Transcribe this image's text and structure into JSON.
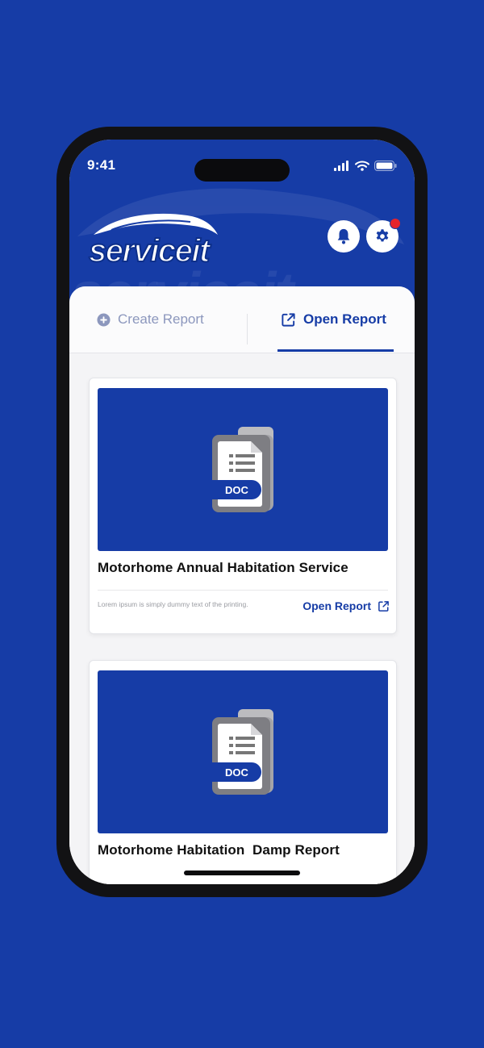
{
  "status_bar": {
    "time": "9:41"
  },
  "brand": {
    "logo_text": "serviceit",
    "color": "#163ca6",
    "notification_dot_color": "#e5232b"
  },
  "header_actions": [
    {
      "name": "bell-icon",
      "has_notification": false
    },
    {
      "name": "gear-icon",
      "has_notification": true
    }
  ],
  "tabs": [
    {
      "label": "Create Report",
      "icon": "plus-circle-icon",
      "active": false
    },
    {
      "label": "Open Report",
      "icon": "external-link-icon",
      "active": true
    }
  ],
  "reports": [
    {
      "thumbnail_label": "DOC",
      "title": "Motorhome Annual Habitation Service",
      "description": "Lorem ipsum is simply dummy text of the printing.",
      "action_label": "Open Report"
    },
    {
      "thumbnail_label": "DOC",
      "title": "Motorhome Habitation  Damp Report"
    }
  ]
}
